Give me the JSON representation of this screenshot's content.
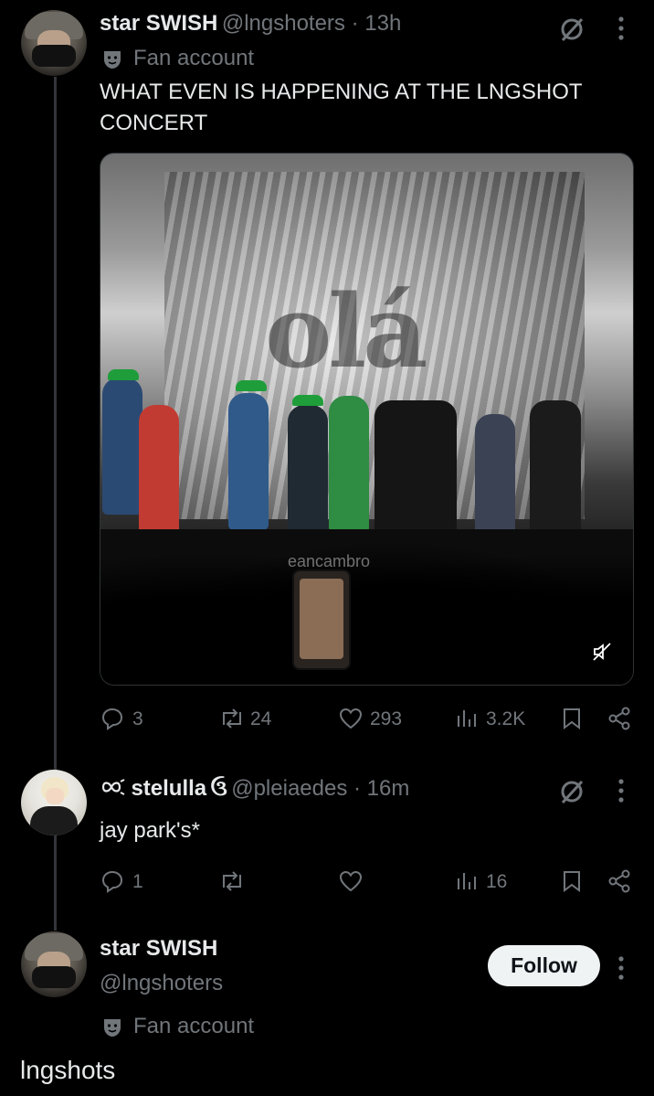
{
  "tweet1": {
    "display_name": "star SWISH",
    "handle_time": "@lngshoters · 13h",
    "badge_label": "Fan account",
    "text": "WHAT EVEN IS HAPPENING AT THE LNGSHOT CONCERT",
    "media": {
      "screen_text": "olá",
      "watermark": "eancambro"
    },
    "stats": {
      "replies": "3",
      "reposts": "24",
      "likes": "293",
      "views": "3.2K"
    }
  },
  "tweet2": {
    "name_prefix": "💖",
    "display_name": "stelulla",
    "name_suffix": "அ",
    "handle_time": "@pleiaedes · 16m",
    "text": "jay park's*",
    "stats": {
      "replies": "1",
      "reposts": "",
      "likes": "",
      "views": "16"
    }
  },
  "profile": {
    "display_name": "star SWISH",
    "handle": "@lngshoters",
    "badge_label": "Fan account",
    "follow_label": "Follow",
    "bio": "lngshots"
  },
  "colors": {
    "muted": "#71767b",
    "text": "#e7e9ea",
    "accent_green": "#1f9d3a"
  }
}
